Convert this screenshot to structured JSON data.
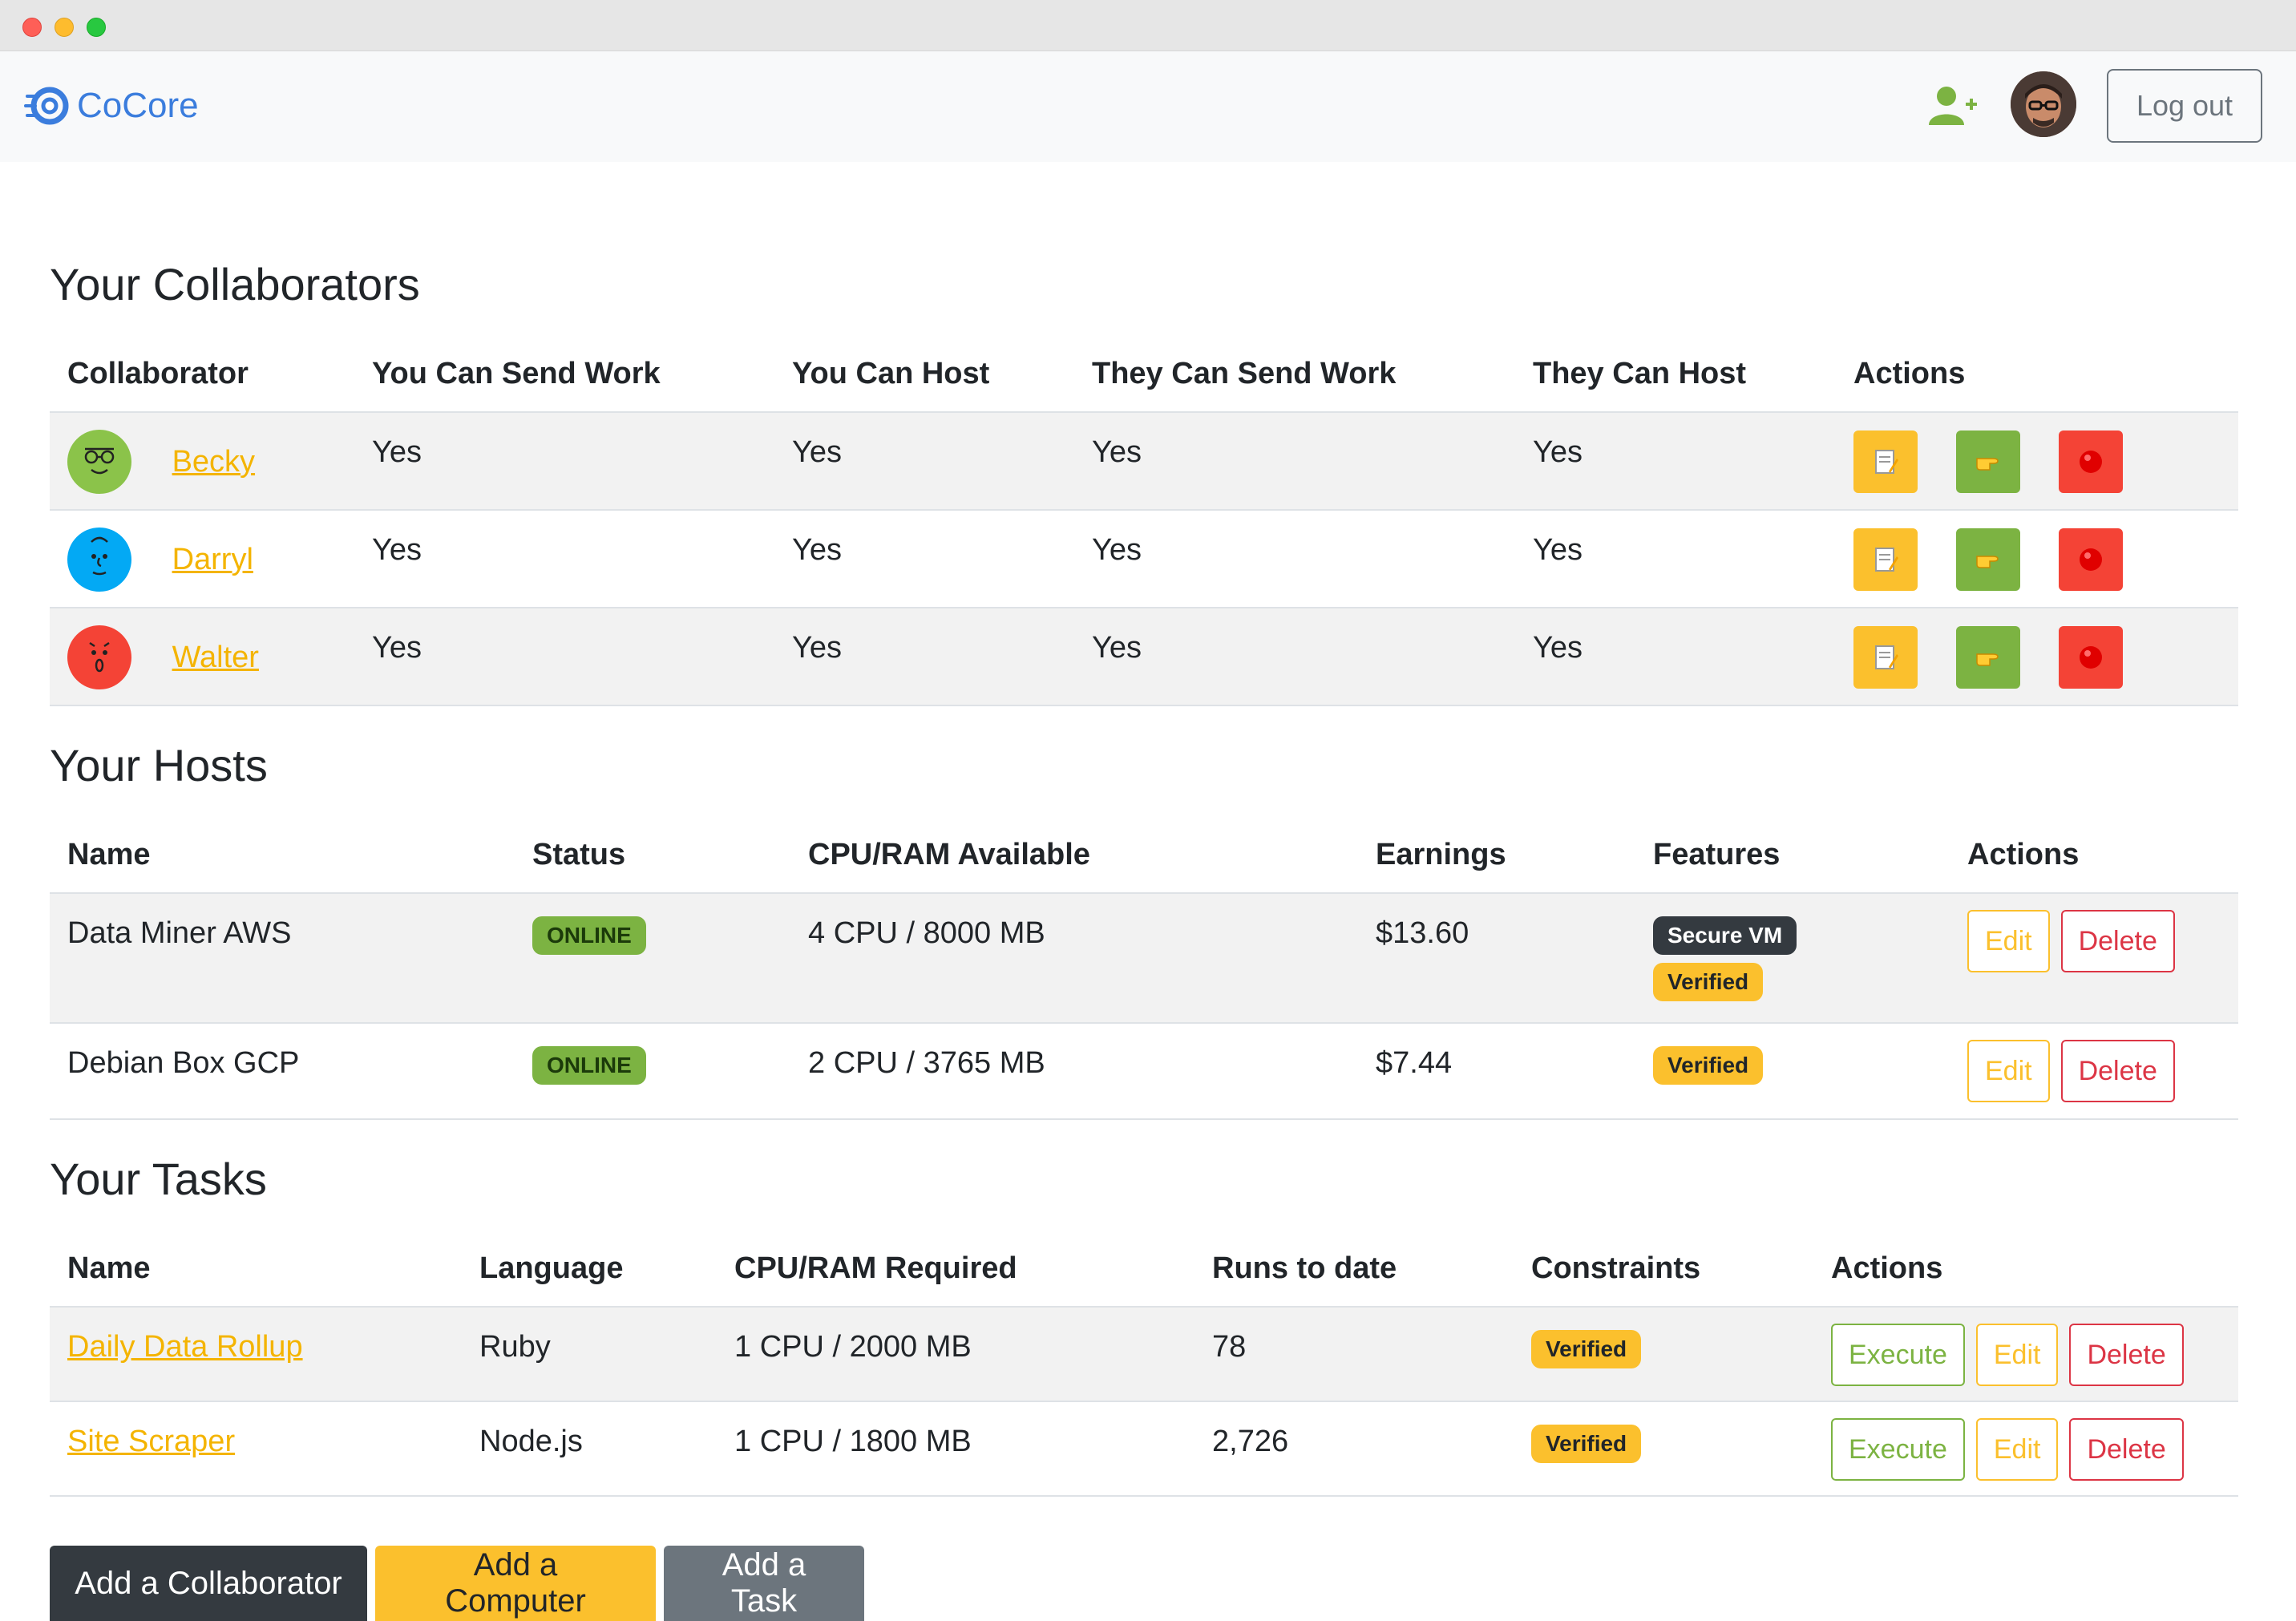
{
  "app": {
    "brand": "CoCore",
    "logout_label": "Log out"
  },
  "collaborators": {
    "title": "Your Collaborators",
    "columns": [
      "Collaborator",
      "You Can Send Work",
      "You Can Host",
      "They Can Send Work",
      "They Can Host",
      "Actions"
    ],
    "rows": [
      {
        "name": "Becky",
        "avatar_color": "#8bc34a",
        "you_send": "Yes",
        "you_host": "Yes",
        "they_send": "Yes",
        "they_host": "Yes"
      },
      {
        "name": "Darryl",
        "avatar_color": "#03a9f4",
        "you_send": "Yes",
        "you_host": "Yes",
        "they_send": "Yes",
        "they_host": "Yes"
      },
      {
        "name": "Walter",
        "avatar_color": "#f44336",
        "you_send": "Yes",
        "you_host": "Yes",
        "they_send": "Yes",
        "they_host": "Yes"
      }
    ]
  },
  "hosts": {
    "title": "Your Hosts",
    "columns": [
      "Name",
      "Status",
      "CPU/RAM Available",
      "Earnings",
      "Features",
      "Actions"
    ],
    "rows": [
      {
        "name": "Data Miner AWS",
        "status": "ONLINE",
        "cpu_ram": "4 CPU / 8000 MB",
        "earnings": "$13.60",
        "feature_1": "Secure VM",
        "feature_2": "Verified",
        "edit": "Edit",
        "delete": "Delete"
      },
      {
        "name": "Debian Box GCP",
        "status": "ONLINE",
        "cpu_ram": "2 CPU / 3765 MB",
        "earnings": "$7.44",
        "feature_1": "Verified",
        "edit": "Edit",
        "delete": "Delete"
      }
    ]
  },
  "tasks": {
    "title": "Your Tasks",
    "columns": [
      "Name",
      "Language",
      "CPU/RAM Required",
      "Runs to date",
      "Constraints",
      "Actions"
    ],
    "rows": [
      {
        "name": "Daily Data Rollup",
        "language": "Ruby",
        "cpu_ram": "1 CPU / 2000 MB",
        "runs": "78",
        "constraint": "Verified",
        "execute": "Execute",
        "edit": "Edit",
        "delete": "Delete"
      },
      {
        "name": "Site Scraper",
        "language": "Node.js",
        "cpu_ram": "1 CPU / 1800 MB",
        "runs": "2,726",
        "constraint": "Verified",
        "execute": "Execute",
        "edit": "Edit",
        "delete": "Delete"
      }
    ]
  },
  "footer_buttons": {
    "add_collaborator": "Add a Collaborator",
    "add_computer": "Add a Computer",
    "add_task": "Add a Task"
  },
  "colors": {
    "brand": "#3b7ddd",
    "link": "#f4b400",
    "success": "#7cb342",
    "warning": "#fbc02d",
    "danger": "#f44336",
    "dark": "#343a40",
    "secondary": "#6c757d"
  }
}
